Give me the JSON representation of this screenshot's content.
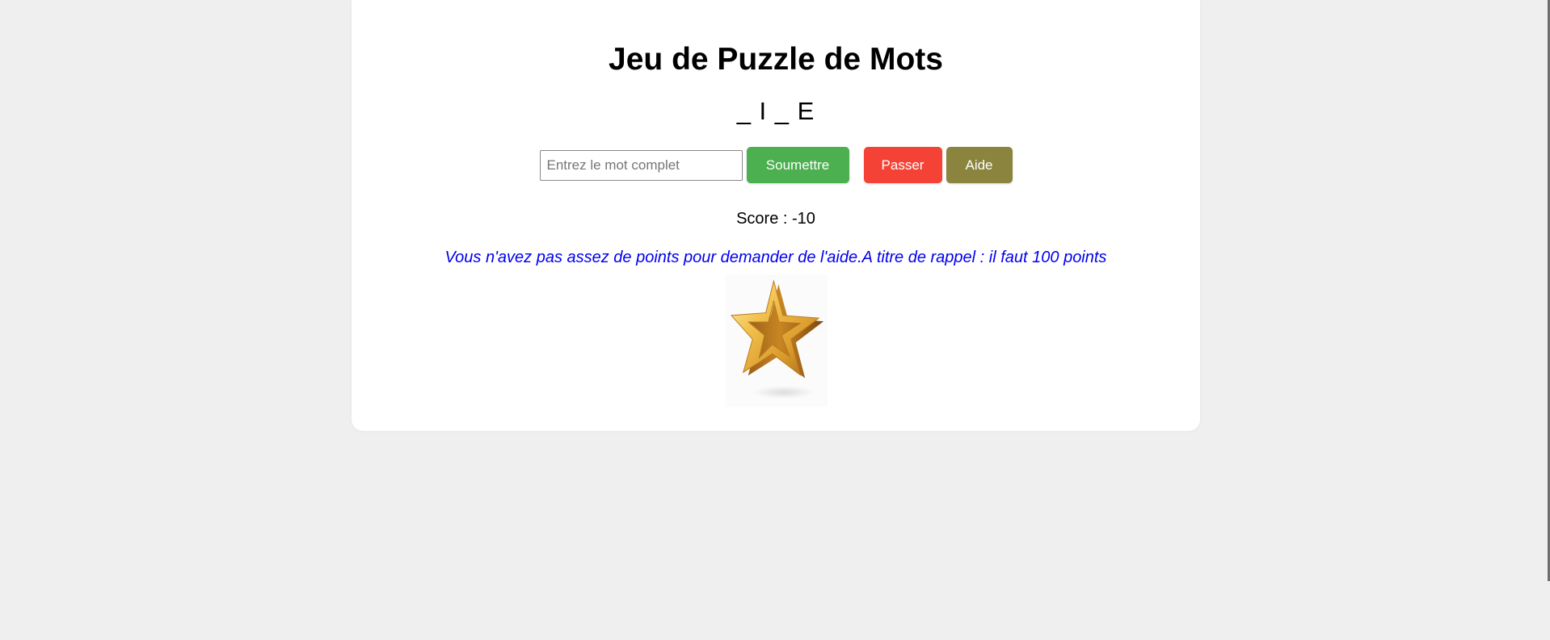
{
  "game": {
    "title": "Jeu de Puzzle de Mots",
    "puzzle": "_ I _ E",
    "input": {
      "placeholder": "Entrez le mot complet",
      "value": ""
    },
    "buttons": {
      "submit": "Soumettre",
      "skip": "Passer",
      "help": "Aide"
    },
    "score_text": "Score : -10",
    "message": "Vous n'avez pas assez de points pour demander de l'aide.A titre de rappel : il faut 100 points",
    "star_icon": "star-icon"
  },
  "colors": {
    "background": "#efefef",
    "card": "#ffffff",
    "submit": "#4caf50",
    "skip": "#f44336",
    "help": "#8a843e",
    "message": "#0000ee"
  }
}
